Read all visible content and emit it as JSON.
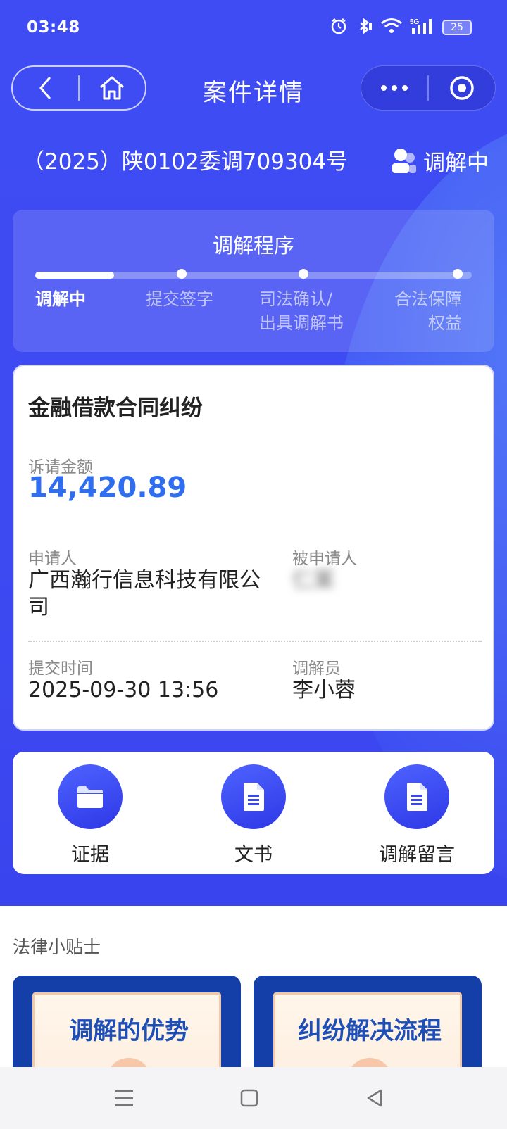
{
  "status_bar": {
    "time": "03:48",
    "battery": "25",
    "icons": [
      "alarm-icon",
      "bluetooth-icon",
      "wifi-icon",
      "5g-signal-icon",
      "battery-icon"
    ]
  },
  "nav": {
    "title": "案件详情",
    "back_icon": "chevron-left-icon",
    "home_icon": "home-icon",
    "more_icon": "more-dots-icon",
    "close_icon": "target-close-icon"
  },
  "case": {
    "number": "（2025）陕0102委调709304号",
    "status": "调解中",
    "status_icon": "person-status-icon"
  },
  "procedure": {
    "title": "调解程序",
    "progress_fraction": 0.18,
    "steps": [
      {
        "label": "调解中",
        "active": true
      },
      {
        "label": "提交签字",
        "active": false
      },
      {
        "label": "司法确认/\n出具调解书",
        "active": false
      },
      {
        "label": "合法保障\n权益",
        "active": false
      }
    ]
  },
  "card": {
    "case_type": "金融借款合同纠纷",
    "amount_label": "诉请金额",
    "amount": "14,420.89",
    "applicant_label": "申请人",
    "applicant": "广西瀚行信息科技有限公司",
    "respondent_label": "被申请人",
    "respondent": "仁某",
    "submit_time_label": "提交时间",
    "submit_time": "2025-09-30 13:56",
    "mediator_label": "调解员",
    "mediator": "李小蓉"
  },
  "actions": [
    {
      "label": "证据",
      "icon": "folder-icon"
    },
    {
      "label": "文书",
      "icon": "document-icon"
    },
    {
      "label": "调解留言",
      "icon": "document-icon"
    }
  ],
  "tips": {
    "title": "法律小贴士",
    "items": [
      {
        "label": "调解的优势"
      },
      {
        "label": "纠纷解决流程"
      }
    ]
  },
  "colors": {
    "primary": "#3f4cf4",
    "amount": "#2f6ef1",
    "tip_bg": "#143ea8",
    "tip_text": "#1d4fb7"
  }
}
